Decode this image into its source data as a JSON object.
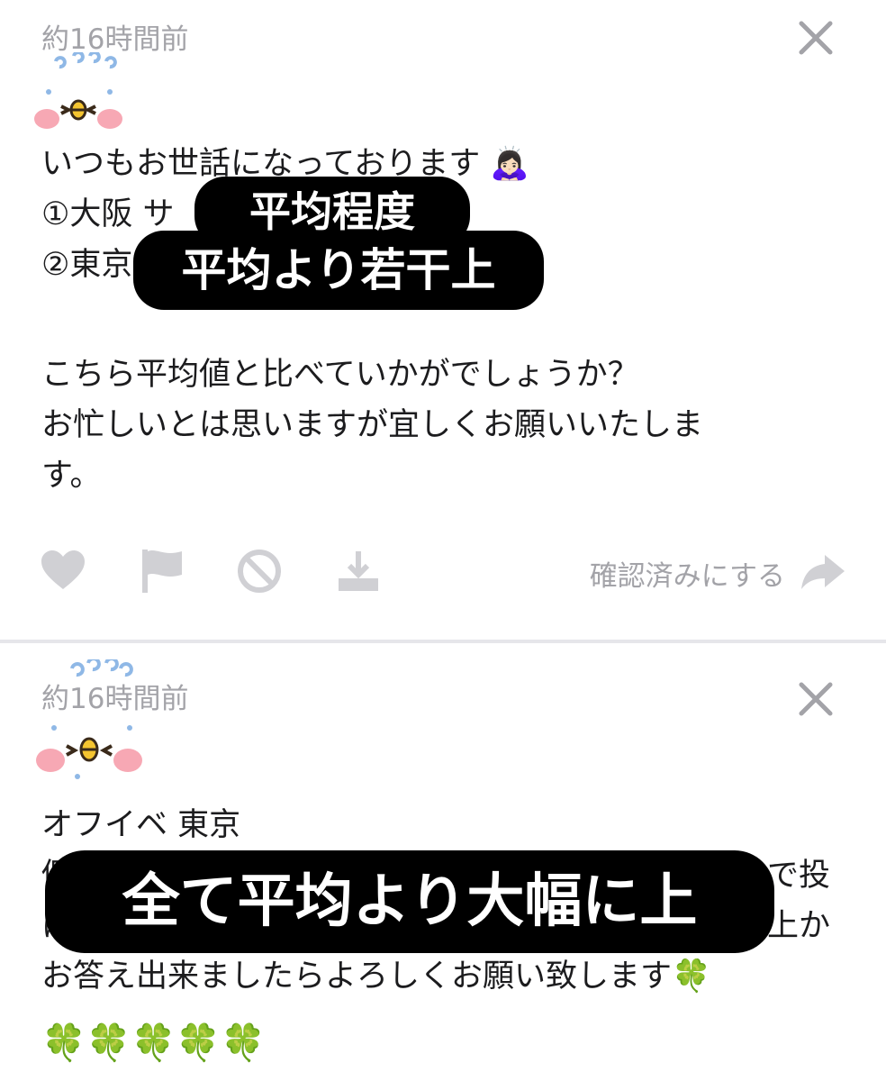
{
  "posts": [
    {
      "timestamp": "約16時間前",
      "lines": [
        "いつもお世話になっております 🙇🏻‍♀️",
        "①大阪 サ",
        "②東京",
        "",
        "こちら平均値と比べていかがでしょうか？",
        "お忙しいとは思いますが宜しくお願いいたしま",
        "す。"
      ],
      "mark_read_label": "確認済みにする",
      "overlays": [
        "平均程度",
        "平均より若干上"
      ]
    },
    {
      "timestamp": "約16時間前",
      "lines": [
        "オフイベ 東京",
        "個",
        "で投",
        "は",
        "上か",
        "お答え出来ましたらよろしくお願い致します🍀",
        "🍀🍀🍀🍀🍀"
      ],
      "overlays": [
        "全て平均より大幅に上"
      ]
    }
  ],
  "icons": {
    "close": "close-icon",
    "like": "heart-icon",
    "report": "flag-icon",
    "block": "block-icon",
    "download": "download-icon",
    "forward": "forward-arrow-icon"
  },
  "colors": {
    "text": "#1c1c1e",
    "muted": "#a3a3a8",
    "icon": "#d0d0d4",
    "overlay_bg": "#000000",
    "overlay_text": "#ffffff",
    "clover": "#3aa84a"
  }
}
